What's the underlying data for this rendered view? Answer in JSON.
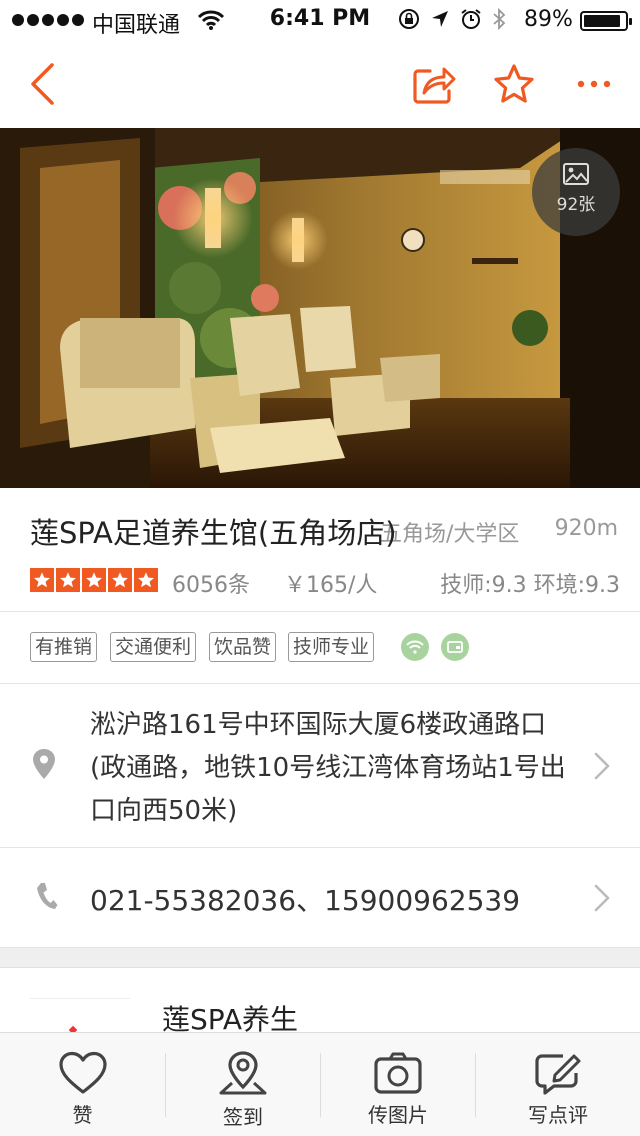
{
  "status_bar": {
    "carrier": "中国联通",
    "time": "6:41 PM",
    "battery_percent": "89%",
    "battery_level": 0.89
  },
  "nav": {
    "back_icon": "chevron-left-icon",
    "share_icon": "share-icon",
    "favorite_icon": "star-outline-icon",
    "more_icon": "more-icon",
    "accent_color": "#f05a22"
  },
  "hero": {
    "photo_count": "92张"
  },
  "shop": {
    "name": "莲SPA足道养生馆(五角场店)",
    "area": "五角场/大学区",
    "distance": "920m",
    "rating_stars": 5,
    "review_count": "6056条",
    "price": "￥165/人",
    "scores": "技师:9.3 环境:9.3"
  },
  "tags": [
    "有推销",
    "交通便利",
    "饮品赞",
    "技师专业"
  ],
  "facility_icons": [
    "wifi-icon",
    "card-payment-icon"
  ],
  "address": {
    "text": "淞沪路161号中环国际大厦6楼政通路口(政通路，地铁10号线江湾体育场站1号出口向西50米)"
  },
  "phone": {
    "text": "021-55382036、15900962539"
  },
  "card": {
    "title": "莲SPA养生"
  },
  "tabbar": {
    "items": [
      {
        "label": "赞",
        "icon": "heart-icon"
      },
      {
        "label": "签到",
        "icon": "location-pin-icon"
      },
      {
        "label": "传图片",
        "icon": "camera-icon"
      },
      {
        "label": "写点评",
        "icon": "edit-icon"
      }
    ]
  }
}
